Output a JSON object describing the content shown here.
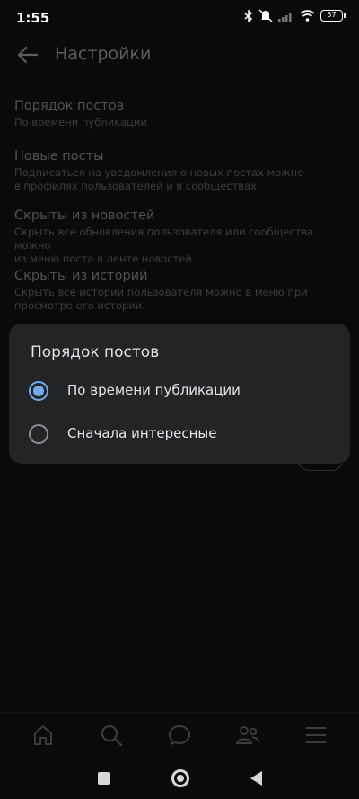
{
  "status_bar": {
    "time": "1:55",
    "battery": "57"
  },
  "header": {
    "title": "Настройки"
  },
  "settings": [
    {
      "title": "Порядок постов",
      "desc": "По времени публикации"
    },
    {
      "title": "Новые посты",
      "desc": "Подписаться на уведомления о новых постах можно\nв профилях пользователей и в сообществах"
    },
    {
      "title": "Скрыты из новостей",
      "desc": "Скрыть все обновления пользователя или сообщества можно\nиз меню поста в ленте новостей"
    },
    {
      "title": "Скрыты из историй",
      "desc": "Скрыть все истории пользователя можно в меню при\nпросмотре его истории."
    }
  ],
  "dialog": {
    "title": "Порядок постов",
    "options": [
      {
        "label": "По времени публикации",
        "selected": true
      },
      {
        "label": "Сначала интересные",
        "selected": false
      }
    ]
  },
  "tabbar": {
    "icons": [
      "home-icon",
      "search-icon",
      "messages-icon",
      "friends-icon",
      "menu-icon"
    ]
  },
  "colors": {
    "accent": "#71aaeb",
    "dialog_bg": "#232426",
    "background": "#0a0a0a"
  }
}
